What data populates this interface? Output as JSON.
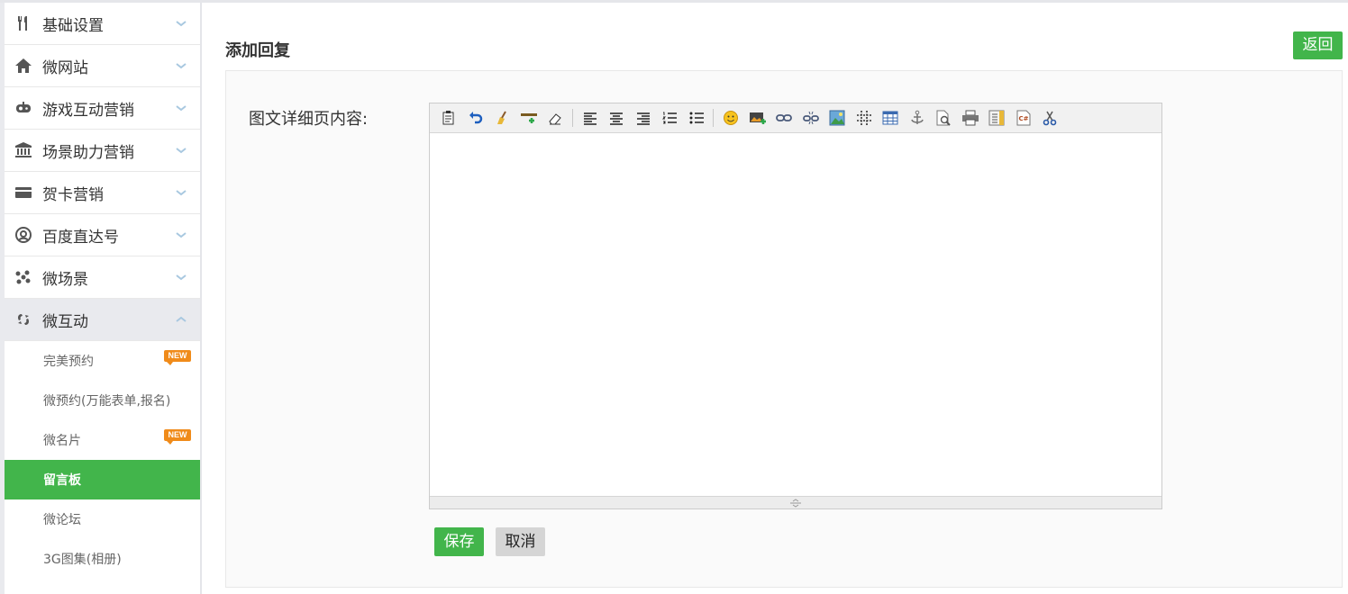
{
  "sidebar": {
    "items": [
      {
        "label": "基础设置",
        "icon": "tools-icon"
      },
      {
        "label": "微网站",
        "icon": "home-icon"
      },
      {
        "label": "游戏互动营销",
        "icon": "gamepad-icon"
      },
      {
        "label": "场景助力营销",
        "icon": "bank-icon"
      },
      {
        "label": "贺卡营销",
        "icon": "card-icon"
      },
      {
        "label": "百度直达号",
        "icon": "baidu-icon"
      },
      {
        "label": "微场景",
        "icon": "molecule-icon"
      },
      {
        "label": "微互动",
        "icon": "link-swirl-icon"
      }
    ],
    "sub_items": [
      {
        "label": "完美预约",
        "badge": "NEW"
      },
      {
        "label": "微预约(万能表单,报名)",
        "badge": ""
      },
      {
        "label": "微名片",
        "badge": "NEW"
      },
      {
        "label": "留言板",
        "badge": ""
      },
      {
        "label": "微论坛",
        "badge": ""
      },
      {
        "label": "3G图集(相册)",
        "badge": ""
      }
    ],
    "active_sub": "留言板"
  },
  "header": {
    "title": "添加回复",
    "back_label": "返回"
  },
  "form": {
    "content_label": "图文详细页内容:",
    "save_label": "保存",
    "cancel_label": "取消"
  },
  "editor": {
    "toolbar": [
      "paste-icon",
      "undo-icon",
      "clean-icon",
      "insert-line-icon",
      "eraser-icon",
      "align-left-icon",
      "align-center-icon",
      "align-right-icon",
      "ordered-list-icon",
      "unordered-list-icon",
      "emoji-icon",
      "insert-image-icon",
      "link-icon",
      "unlink-icon",
      "image-icon",
      "grid-icon",
      "table-icon",
      "anchor-icon",
      "preview-icon",
      "print-icon",
      "source-icon",
      "code-csharp-icon",
      "cut-icon"
    ]
  },
  "colors": {
    "accent": "#42b54b",
    "sidebar_bg": "#e9eaee",
    "badge": "#f08b1a"
  }
}
